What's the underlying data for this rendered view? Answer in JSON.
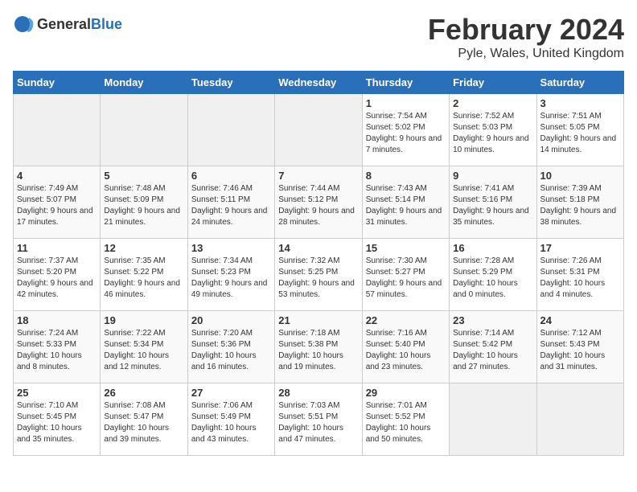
{
  "header": {
    "logo_general": "General",
    "logo_blue": "Blue",
    "month": "February 2024",
    "location": "Pyle, Wales, United Kingdom"
  },
  "weekdays": [
    "Sunday",
    "Monday",
    "Tuesday",
    "Wednesday",
    "Thursday",
    "Friday",
    "Saturday"
  ],
  "weeks": [
    [
      {
        "day": "",
        "sunrise": "",
        "sunset": "",
        "daylight": ""
      },
      {
        "day": "",
        "sunrise": "",
        "sunset": "",
        "daylight": ""
      },
      {
        "day": "",
        "sunrise": "",
        "sunset": "",
        "daylight": ""
      },
      {
        "day": "",
        "sunrise": "",
        "sunset": "",
        "daylight": ""
      },
      {
        "day": "1",
        "sunrise": "Sunrise: 7:54 AM",
        "sunset": "Sunset: 5:02 PM",
        "daylight": "Daylight: 9 hours and 7 minutes."
      },
      {
        "day": "2",
        "sunrise": "Sunrise: 7:52 AM",
        "sunset": "Sunset: 5:03 PM",
        "daylight": "Daylight: 9 hours and 10 minutes."
      },
      {
        "day": "3",
        "sunrise": "Sunrise: 7:51 AM",
        "sunset": "Sunset: 5:05 PM",
        "daylight": "Daylight: 9 hours and 14 minutes."
      }
    ],
    [
      {
        "day": "4",
        "sunrise": "Sunrise: 7:49 AM",
        "sunset": "Sunset: 5:07 PM",
        "daylight": "Daylight: 9 hours and 17 minutes."
      },
      {
        "day": "5",
        "sunrise": "Sunrise: 7:48 AM",
        "sunset": "Sunset: 5:09 PM",
        "daylight": "Daylight: 9 hours and 21 minutes."
      },
      {
        "day": "6",
        "sunrise": "Sunrise: 7:46 AM",
        "sunset": "Sunset: 5:11 PM",
        "daylight": "Daylight: 9 hours and 24 minutes."
      },
      {
        "day": "7",
        "sunrise": "Sunrise: 7:44 AM",
        "sunset": "Sunset: 5:12 PM",
        "daylight": "Daylight: 9 hours and 28 minutes."
      },
      {
        "day": "8",
        "sunrise": "Sunrise: 7:43 AM",
        "sunset": "Sunset: 5:14 PM",
        "daylight": "Daylight: 9 hours and 31 minutes."
      },
      {
        "day": "9",
        "sunrise": "Sunrise: 7:41 AM",
        "sunset": "Sunset: 5:16 PM",
        "daylight": "Daylight: 9 hours and 35 minutes."
      },
      {
        "day": "10",
        "sunrise": "Sunrise: 7:39 AM",
        "sunset": "Sunset: 5:18 PM",
        "daylight": "Daylight: 9 hours and 38 minutes."
      }
    ],
    [
      {
        "day": "11",
        "sunrise": "Sunrise: 7:37 AM",
        "sunset": "Sunset: 5:20 PM",
        "daylight": "Daylight: 9 hours and 42 minutes."
      },
      {
        "day": "12",
        "sunrise": "Sunrise: 7:35 AM",
        "sunset": "Sunset: 5:22 PM",
        "daylight": "Daylight: 9 hours and 46 minutes."
      },
      {
        "day": "13",
        "sunrise": "Sunrise: 7:34 AM",
        "sunset": "Sunset: 5:23 PM",
        "daylight": "Daylight: 9 hours and 49 minutes."
      },
      {
        "day": "14",
        "sunrise": "Sunrise: 7:32 AM",
        "sunset": "Sunset: 5:25 PM",
        "daylight": "Daylight: 9 hours and 53 minutes."
      },
      {
        "day": "15",
        "sunrise": "Sunrise: 7:30 AM",
        "sunset": "Sunset: 5:27 PM",
        "daylight": "Daylight: 9 hours and 57 minutes."
      },
      {
        "day": "16",
        "sunrise": "Sunrise: 7:28 AM",
        "sunset": "Sunset: 5:29 PM",
        "daylight": "Daylight: 10 hours and 0 minutes."
      },
      {
        "day": "17",
        "sunrise": "Sunrise: 7:26 AM",
        "sunset": "Sunset: 5:31 PM",
        "daylight": "Daylight: 10 hours and 4 minutes."
      }
    ],
    [
      {
        "day": "18",
        "sunrise": "Sunrise: 7:24 AM",
        "sunset": "Sunset: 5:33 PM",
        "daylight": "Daylight: 10 hours and 8 minutes."
      },
      {
        "day": "19",
        "sunrise": "Sunrise: 7:22 AM",
        "sunset": "Sunset: 5:34 PM",
        "daylight": "Daylight: 10 hours and 12 minutes."
      },
      {
        "day": "20",
        "sunrise": "Sunrise: 7:20 AM",
        "sunset": "Sunset: 5:36 PM",
        "daylight": "Daylight: 10 hours and 16 minutes."
      },
      {
        "day": "21",
        "sunrise": "Sunrise: 7:18 AM",
        "sunset": "Sunset: 5:38 PM",
        "daylight": "Daylight: 10 hours and 19 minutes."
      },
      {
        "day": "22",
        "sunrise": "Sunrise: 7:16 AM",
        "sunset": "Sunset: 5:40 PM",
        "daylight": "Daylight: 10 hours and 23 minutes."
      },
      {
        "day": "23",
        "sunrise": "Sunrise: 7:14 AM",
        "sunset": "Sunset: 5:42 PM",
        "daylight": "Daylight: 10 hours and 27 minutes."
      },
      {
        "day": "24",
        "sunrise": "Sunrise: 7:12 AM",
        "sunset": "Sunset: 5:43 PM",
        "daylight": "Daylight: 10 hours and 31 minutes."
      }
    ],
    [
      {
        "day": "25",
        "sunrise": "Sunrise: 7:10 AM",
        "sunset": "Sunset: 5:45 PM",
        "daylight": "Daylight: 10 hours and 35 minutes."
      },
      {
        "day": "26",
        "sunrise": "Sunrise: 7:08 AM",
        "sunset": "Sunset: 5:47 PM",
        "daylight": "Daylight: 10 hours and 39 minutes."
      },
      {
        "day": "27",
        "sunrise": "Sunrise: 7:06 AM",
        "sunset": "Sunset: 5:49 PM",
        "daylight": "Daylight: 10 hours and 43 minutes."
      },
      {
        "day": "28",
        "sunrise": "Sunrise: 7:03 AM",
        "sunset": "Sunset: 5:51 PM",
        "daylight": "Daylight: 10 hours and 47 minutes."
      },
      {
        "day": "29",
        "sunrise": "Sunrise: 7:01 AM",
        "sunset": "Sunset: 5:52 PM",
        "daylight": "Daylight: 10 hours and 50 minutes."
      },
      {
        "day": "",
        "sunrise": "",
        "sunset": "",
        "daylight": ""
      },
      {
        "day": "",
        "sunrise": "",
        "sunset": "",
        "daylight": ""
      }
    ]
  ]
}
